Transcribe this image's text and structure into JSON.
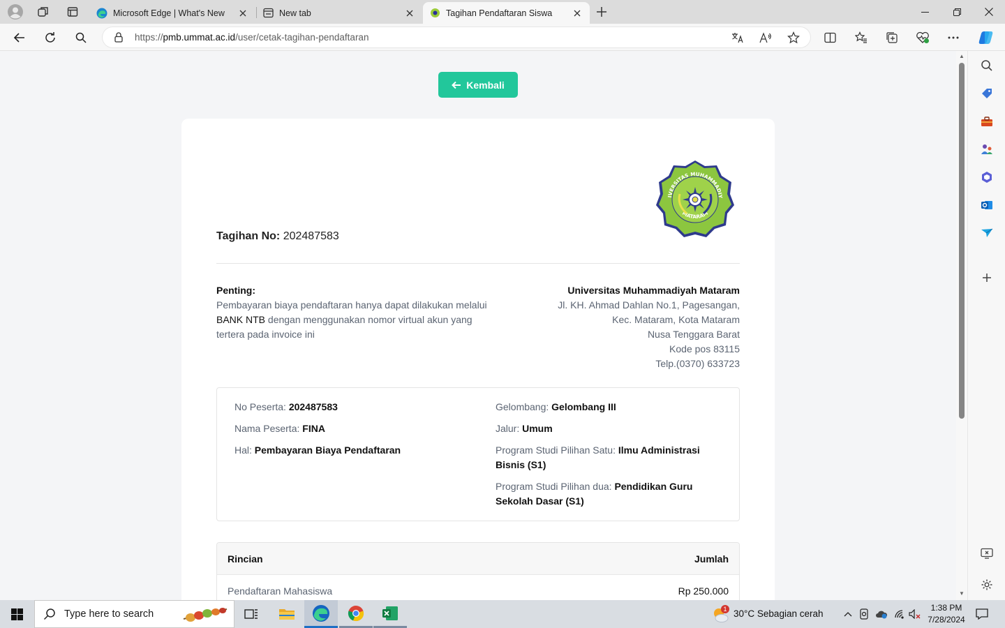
{
  "browser": {
    "tabs": [
      {
        "title": "Microsoft Edge | What's New",
        "icon": "edge-icon",
        "active": false
      },
      {
        "title": "New tab",
        "icon": "newtab-icon",
        "active": false
      },
      {
        "title": "Tagihan Pendaftaran Siswa",
        "icon": "site-favicon",
        "active": true
      }
    ],
    "url_prefix": "https://",
    "url_host": "pmb.ummat.ac.id",
    "url_path": "/user/cetak-tagihan-pendaftaran"
  },
  "page": {
    "back_label": "Kembali",
    "invoice_label": "Tagihan No:",
    "invoice_number": "202487583",
    "notice_title": "Penting:",
    "notice_line1": "Pembayaran biaya pendaftaran hanya dapat dilakukan melalui",
    "notice_bank": "BANK NTB",
    "notice_line2": " dengan menggunakan nomor virtual akun yang",
    "notice_line3": "tertera pada invoice ini",
    "university": {
      "name": "Universitas Muhammadiyah Mataram",
      "address1": "Jl. KH. Ahmad Dahlan No.1, Pagesangan,",
      "address2": "Kec. Mataram, Kota Mataram",
      "address3": "Nusa Tenggara Barat",
      "postal": "Kode pos 83115",
      "phone": "Telp.(0370) 633723"
    },
    "logo_text_top": "UNIVERSITAS MUHAMMADIYAH",
    "logo_text_bottom": "MATARAM",
    "participant": {
      "no_label": "No Peserta:",
      "no_value": "202487583",
      "name_label": "Nama Peserta:",
      "name_value": "FINA",
      "hal_label": "Hal:",
      "hal_value": "Pembayaran Biaya Pendaftaran",
      "wave_label": "Gelombang:",
      "wave_value": "Gelombang III",
      "path_label": "Jalur:",
      "path_value": "Umum",
      "prodi1_label": "Program Studi Pilihan Satu:",
      "prodi1_value_a": "Ilmu Administrasi",
      "prodi1_value_b": "Bisnis (S1)",
      "prodi2_label": "Program Studi Pilihan dua:",
      "prodi2_value_a": "Pendidikan Guru",
      "prodi2_value_b": "Sekolah Dasar (S1)"
    },
    "details": {
      "col_item": "Rincian",
      "col_amount": "Jumlah",
      "rows": [
        {
          "item": "Pendaftaran Mahasiswa",
          "amount": "Rp 250.000"
        }
      ]
    }
  },
  "taskbar": {
    "search_placeholder": "Type here to search",
    "weather": "30°C  Sebagian cerah",
    "weather_badge": "1",
    "time": "1:38 PM",
    "date": "7/28/2024"
  },
  "colors": {
    "accent_button": "#22c79b",
    "logo_green": "#8cc63f",
    "logo_blue": "#2a2f9c"
  }
}
